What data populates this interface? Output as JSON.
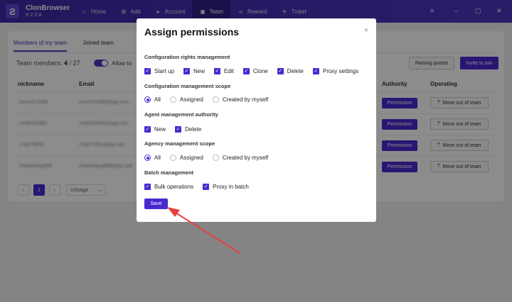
{
  "app": {
    "name": "ClonBrowser",
    "version": "V 2.2.4",
    "logo_letter": "Ƨ"
  },
  "nav": [
    {
      "label": "Home",
      "icon": "home-icon",
      "glyph": "⌂"
    },
    {
      "label": "Add",
      "icon": "plus-square-icon",
      "glyph": "⊞"
    },
    {
      "label": "Account",
      "icon": "user-icon",
      "glyph": "●"
    },
    {
      "label": "Team",
      "icon": "team-icon",
      "glyph": "▣",
      "active": true
    },
    {
      "label": "Reward",
      "icon": "share-icon",
      "glyph": "≺"
    },
    {
      "label": "Ticket",
      "icon": "paper-plane-icon",
      "glyph": "✈"
    }
  ],
  "window_controls": {
    "menu": "≡",
    "minimize": "–",
    "maximize": "▢",
    "close": "✕"
  },
  "team_page": {
    "tabs": [
      "Members of my team",
      "Joined team"
    ],
    "members_label": "Team members:",
    "members_count": "4",
    "members_total": "/ 27",
    "allow_label": "Allow to",
    "raising_quotas": "Raising quotas",
    "invite": "Invite to join",
    "columns": {
      "nickname": "nickname",
      "email": "Email",
      "authority": "Authority",
      "operating": "Operating"
    },
    "rows": [
      {
        "nickname": "secnet13489",
        "email": "secnet13489@qq.com",
        "permission": "Permission",
        "move": "Move out of team"
      },
      {
        "nickname": "1448202965",
        "email": "1448202965@qq.com",
        "permission": "Permission",
        "move": "Move out of team"
      },
      {
        "nickname": "178275655",
        "email": "178275551@qq.com",
        "permission": "Permission",
        "move": "Move out of team"
      },
      {
        "nickname": "zhaoshang998",
        "email": "zhaoshang998@qq.com",
        "permission": "Permission",
        "move": "Move out of team"
      }
    ],
    "pagination": {
      "prev": "‹",
      "current": "1",
      "next": "›",
      "page_size": "10/page"
    }
  },
  "modal": {
    "title": "Assign permissions",
    "close": "×",
    "sections": {
      "config_rights": {
        "title": "Configuration rights management",
        "options": [
          "Start up",
          "New",
          "Edit",
          "Clone",
          "Delete",
          "Proxy settings"
        ]
      },
      "config_scope": {
        "title": "Configuration management scope",
        "options": [
          "All",
          "Assigned",
          "Created by myself"
        ],
        "selected": "All"
      },
      "agent_authority": {
        "title": "Agent management authority",
        "options": [
          "New",
          "Delete"
        ]
      },
      "agency_scope": {
        "title": "Agency management scope",
        "options": [
          "All",
          "Assigned",
          "Created by myself"
        ],
        "selected": "All"
      },
      "batch": {
        "title": "Batch management",
        "options": [
          "Bulk operations",
          "Proxy in batch"
        ]
      }
    },
    "save": "Save"
  },
  "colors": {
    "accent": "#4a28d0",
    "topbar": "#3c2aa8",
    "annotation_arrow": "#e8413c"
  }
}
